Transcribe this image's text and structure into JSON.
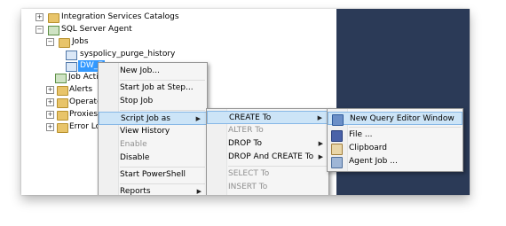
{
  "tree": {
    "integration_services": "Integration Services Catalogs",
    "sql_server_agent": "SQL Server Agent",
    "jobs": "Jobs",
    "job1": "syspolicy_purge_history",
    "job2": "DW_E",
    "job_activity": "Job Activ",
    "alerts": "Alerts",
    "operators": "Operator",
    "proxies": "Proxies",
    "error_logs": "Error Log"
  },
  "context_menu": {
    "new_job": "New Job...",
    "start_job": "Start Job at Step...",
    "stop_job": "Stop Job",
    "script_job_as": "Script Job as",
    "view_history": "View History",
    "enable": "Enable",
    "disable": "Disable",
    "start_powershell": "Start PowerShell",
    "reports": "Reports"
  },
  "script_menu": {
    "create_to": "CREATE To",
    "alter_to": "ALTER To",
    "drop_to": "DROP To",
    "drop_and_create_to": "DROP And CREATE To",
    "select_to": "SELECT To",
    "insert_to": "INSERT To"
  },
  "create_menu": {
    "new_query_editor_window": "New Query Editor Window",
    "file": "File ...",
    "clipboard": "Clipboard",
    "agent_job": "Agent Job ..."
  },
  "glyphs": {
    "expand": "+",
    "collapse": "−",
    "submenu_arrow": "▶"
  }
}
